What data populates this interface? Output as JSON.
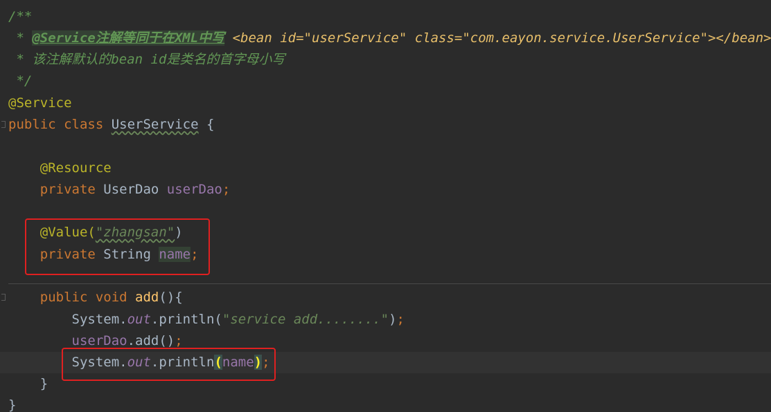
{
  "editor": {
    "theme": "darcula",
    "background": "#2b2b2b",
    "highlight_box_color": "#e02020"
  },
  "code": {
    "l1": "/**",
    "l2_prefix": " * ",
    "l2_tag": "@Service注解等同于在XML中写",
    "l2_xml": " <bean id=\"userService\" class=\"com.eayon.service.UserService\"></bean>",
    "l3": " * 该注解默认的bean id是类名的首字母小写",
    "l4": " */",
    "l5": "@Service",
    "l6_kw": "public class ",
    "l6_class": "UserService",
    "l6_rest": " {",
    "l8_anno": "@Resource",
    "l9_kw": "private ",
    "l9_type": "UserDao ",
    "l9_field": "userDao",
    "l9_semi": ";",
    "l11_anno": "@Value(",
    "l11_str": "\"zhangsan\"",
    "l11_close": ")",
    "l12_kw": "private ",
    "l12_type": "String ",
    "l12_field": "name",
    "l12_semi": ";",
    "l14_kw": "public void ",
    "l14_method": "add",
    "l14_rest": "(){",
    "l15_sys": "System.",
    "l15_out": "out",
    "l15_call": ".println(",
    "l15_str": "\"service add........\"",
    "l15_close": ")",
    "l15_semi": ";",
    "l16_field": "userDao",
    "l16_call": ".add()",
    "l16_semi": ";",
    "l17_sys": "System.",
    "l17_out": "out",
    "l17_call": ".println",
    "l17_open": "(",
    "l17_arg": "name",
    "l17_close": ")",
    "l17_semi": ";",
    "l18": "}",
    "l19": "}"
  }
}
